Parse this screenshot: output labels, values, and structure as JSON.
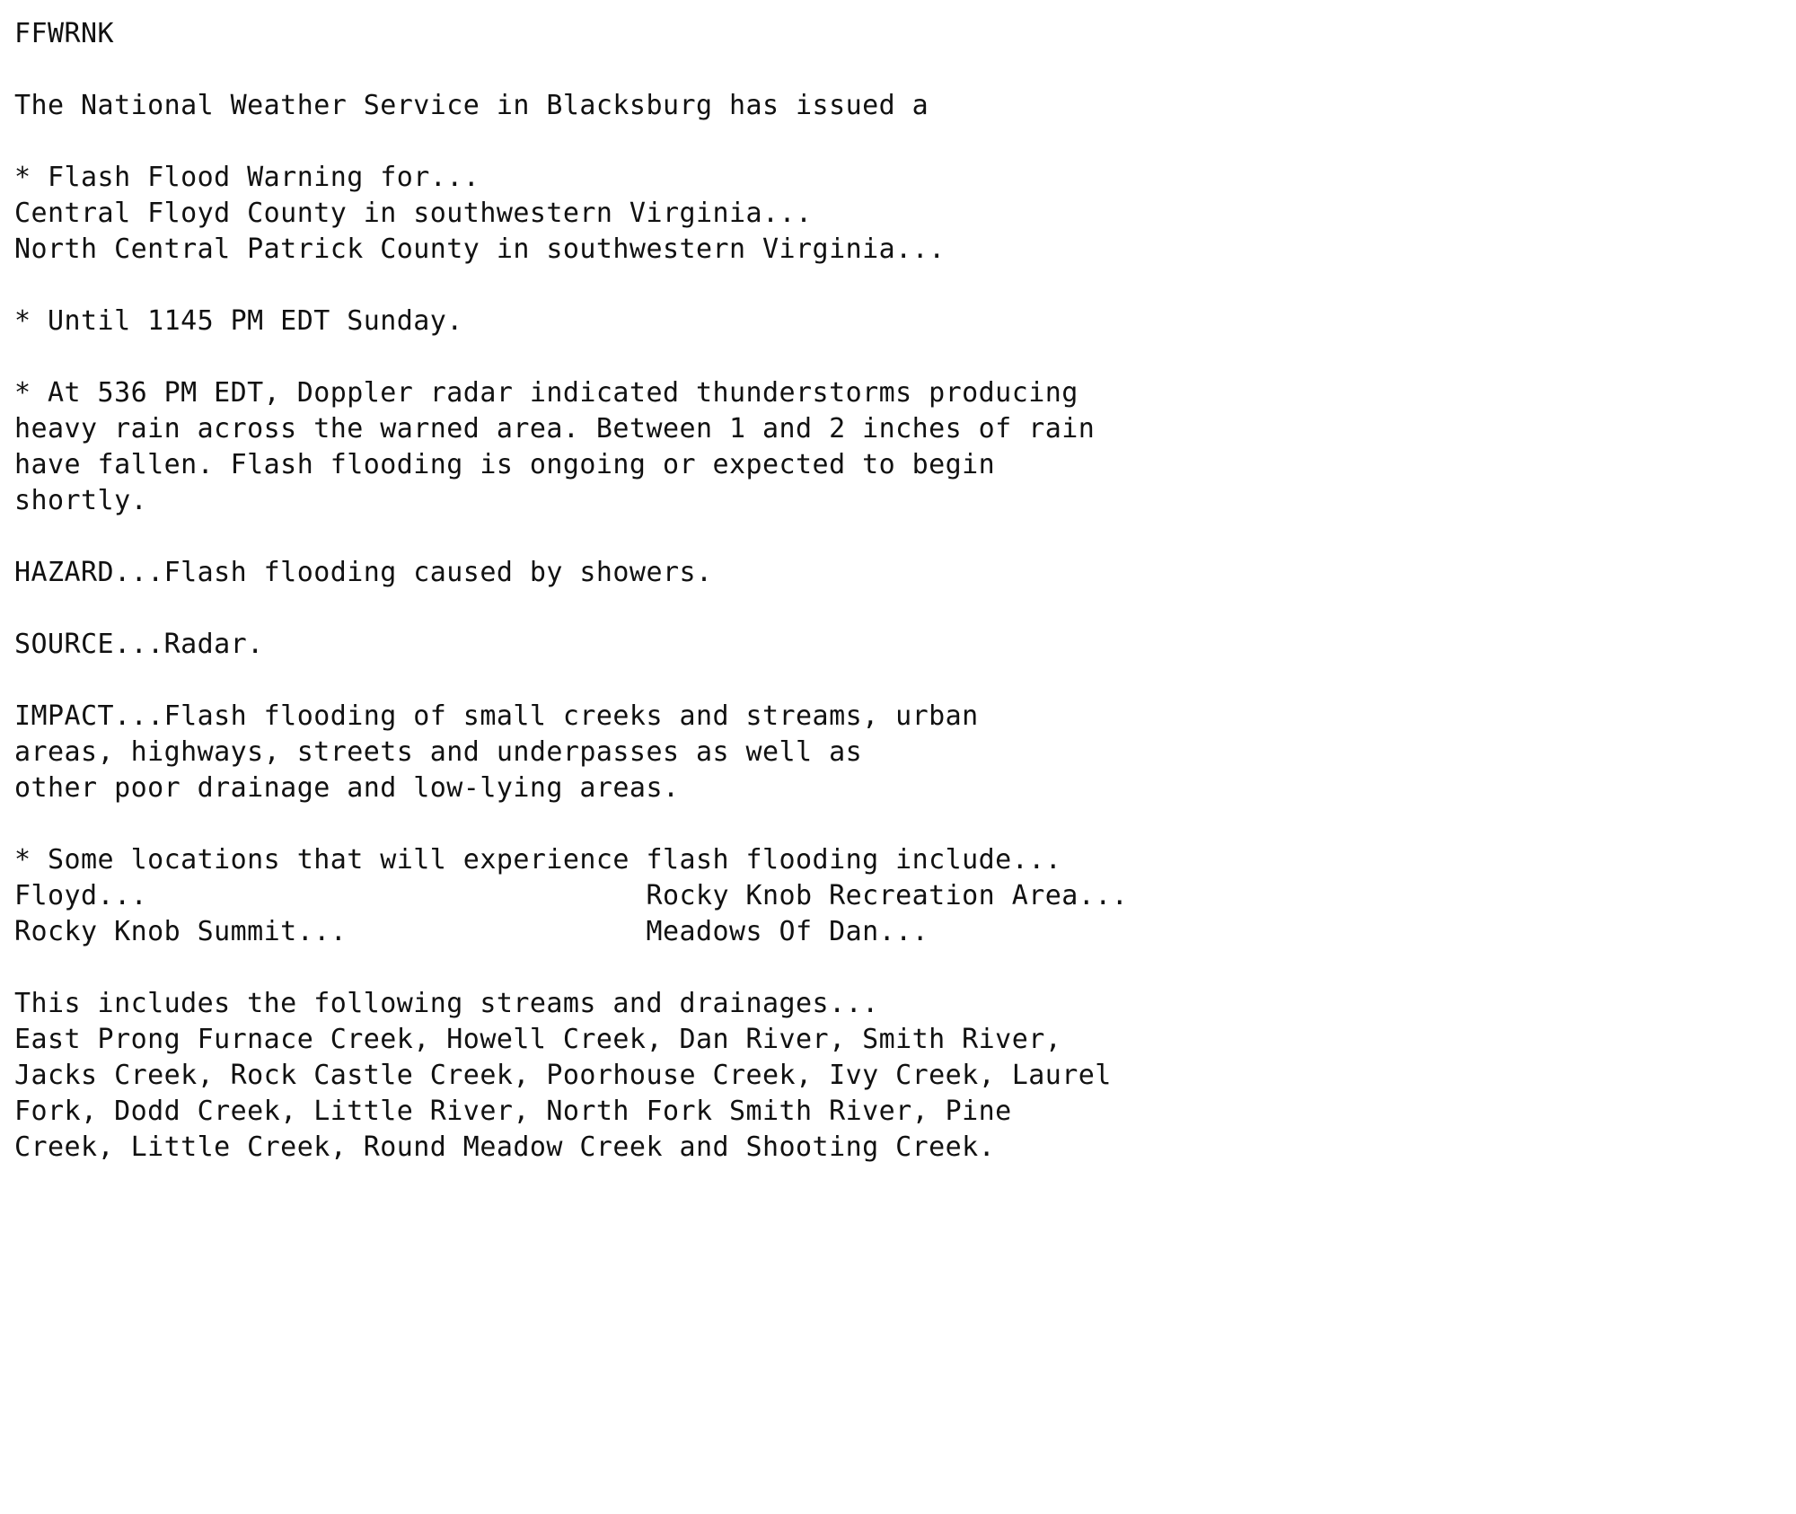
{
  "document": {
    "product_id": "FFWRNK",
    "issuing_office": "The National Weather Service in Blacksburg has issued a",
    "background_color": "#ffffff",
    "text_color": "#111111",
    "sections": {
      "warning_for_header": "* Flash Flood Warning for...",
      "counties": [
        "Central Floyd County in southwestern Virginia...",
        "North Central Patrick County in southwestern Virginia..."
      ],
      "expiration": "* Until 1145 PM EDT Sunday.",
      "discussion": [
        "* At 536 PM EDT, Doppler radar indicated thunderstorms producing",
        "heavy rain across the warned area. Between 1 and 2 inches of rain",
        "have fallen. Flash flooding is ongoing or expected to begin",
        "shortly."
      ],
      "hazard": "HAZARD...Flash flooding caused by showers.",
      "source": "SOURCE...Radar.",
      "impact": [
        "IMPACT...Flash flooding of small creeks and streams, urban",
        "areas, highways, streets and underpasses as well as",
        "other poor drainage and low-lying areas."
      ],
      "locations_header": "* Some locations that will experience flash flooding include...",
      "locations": [
        {
          "left": "Floyd...",
          "right": "Rocky Knob Recreation Area..."
        },
        {
          "left": "Rocky Knob Summit...",
          "right": "Meadows Of Dan..."
        }
      ],
      "streams_header": "This includes the following streams and drainages...",
      "streams": [
        "East Prong Furnace Creek, Howell Creek, Dan River, Smith River,",
        "Jacks Creek, Rock Castle Creek, Poorhouse Creek, Ivy Creek, Laurel",
        "Fork, Dodd Creek, Little River, North Fork Smith River, Pine",
        "Creek, Little Creek, Round Meadow Creek and Shooting Creek."
      ]
    },
    "lines": [
      "FFWRNK",
      "",
      "The National Weather Service in Blacksburg has issued a",
      "",
      "* Flash Flood Warning for...",
      "Central Floyd County in southwestern Virginia...",
      "North Central Patrick County in southwestern Virginia...",
      "",
      "* Until 1145 PM EDT Sunday.",
      "",
      "* At 536 PM EDT, Doppler radar indicated thunderstorms producing",
      "heavy rain across the warned area. Between 1 and 2 inches of rain",
      "have fallen. Flash flooding is ongoing or expected to begin",
      "shortly.",
      "",
      "HAZARD...Flash flooding caused by showers.",
      "",
      "SOURCE...Radar.",
      "",
      "IMPACT...Flash flooding of small creeks and streams, urban",
      "areas, highways, streets and underpasses as well as",
      "other poor drainage and low-lying areas.",
      "",
      "* Some locations that will experience flash flooding include...",
      "Floyd...                              Rocky Knob Recreation Area...",
      "Rocky Knob Summit...                  Meadows Of Dan...",
      "",
      "This includes the following streams and drainages...",
      "East Prong Furnace Creek, Howell Creek, Dan River, Smith River,",
      "Jacks Creek, Rock Castle Creek, Poorhouse Creek, Ivy Creek, Laurel",
      "Fork, Dodd Creek, Little River, North Fork Smith River, Pine",
      "Creek, Little Creek, Round Meadow Creek and Shooting Creek."
    ]
  }
}
